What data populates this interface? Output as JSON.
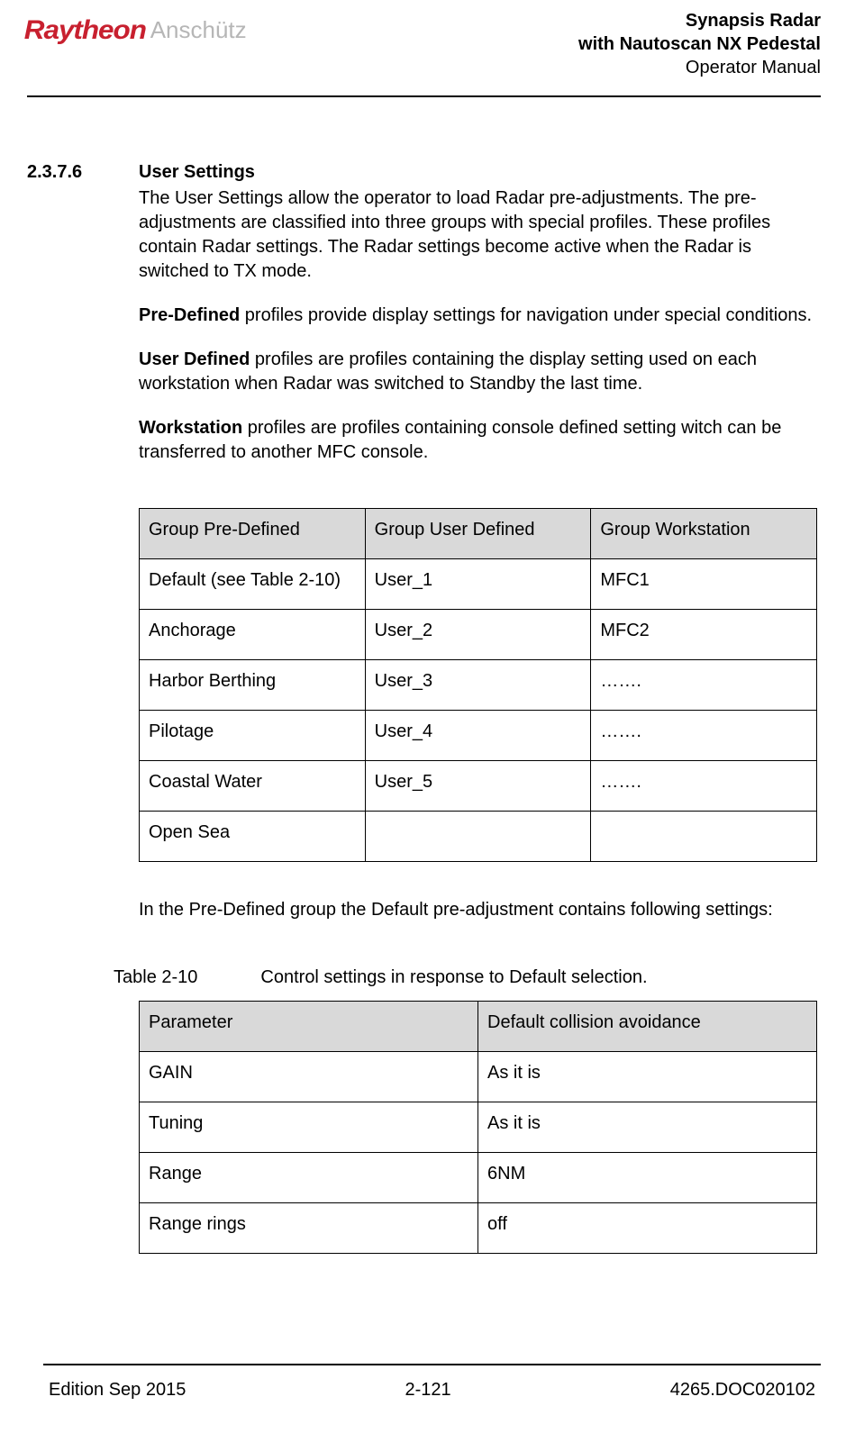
{
  "header": {
    "logo_main": "Raytheon",
    "logo_sub": "Anschütz",
    "title_line1": "Synapsis Radar",
    "title_line2": "with Nautoscan NX Pedestal",
    "title_line3": "Operator Manual"
  },
  "section": {
    "number": "2.3.7.6",
    "title": "User Settings",
    "intro": "The User Settings allow the operator to load Radar pre-adjustments. The pre-adjustments are classified into three groups with special profiles. These profiles contain Radar settings. The Radar settings become active when the Radar is switched to TX mode.",
    "predef_term": "Pre-Defined",
    "predef_text": " profiles provide display settings for navigation under special conditions.",
    "userdef_term": "User Defined",
    "userdef_text": " profiles are profiles containing the display setting used on each workstation when Radar was switched to Standby the last time.",
    "workstation_term": "Workstation",
    "workstation_text": " profiles are profiles containing console defined setting witch can be transferred to another MFC console."
  },
  "table1": {
    "headers": [
      "Group Pre-Defined",
      "Group User Defined",
      "Group Workstation"
    ],
    "rows": [
      [
        "Default (see Table 2-10)",
        "User_1",
        "MFC1"
      ],
      [
        "Anchorage",
        "User_2",
        "MFC2"
      ],
      [
        "Harbor Berthing",
        "User_3",
        "……."
      ],
      [
        "Pilotage",
        "User_4",
        "……."
      ],
      [
        "Coastal Water",
        "User_5",
        "……."
      ],
      [
        "Open Sea",
        "",
        ""
      ]
    ]
  },
  "mid_text": "In the Pre-Defined group the Default pre-adjustment contains following settings:",
  "table2": {
    "caption_num": "Table 2-10",
    "caption_text": "Control settings in response to Default selection.",
    "headers": [
      "Parameter",
      "Default collision avoidance"
    ],
    "rows": [
      [
        "GAIN",
        "As it is"
      ],
      [
        "Tuning",
        "As it is"
      ],
      [
        "Range",
        "6NM"
      ],
      [
        "Range rings",
        "off"
      ]
    ]
  },
  "footer": {
    "left": "Edition Sep 2015",
    "center": "2-121",
    "right": "4265.DOC020102"
  }
}
